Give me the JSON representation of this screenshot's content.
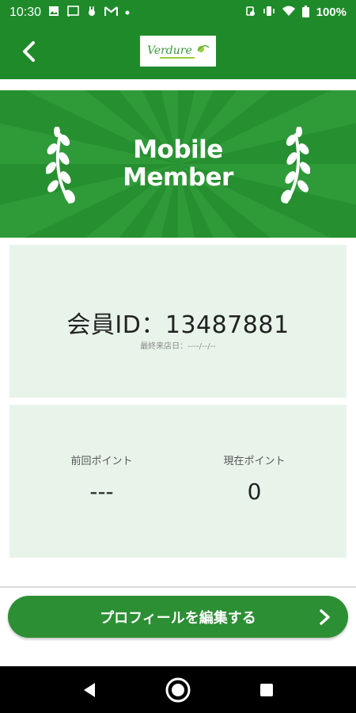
{
  "status_bar": {
    "time": "10:30",
    "left_icons": [
      "image-icon",
      "cast-icon",
      "rabbit-icon",
      "gmail-icon",
      "dot-icon"
    ],
    "right_icons": [
      "vibrate-key-icon",
      "vibrate-icon",
      "wifi-icon",
      "battery-icon"
    ],
    "battery": "100%"
  },
  "header": {
    "logo_text": "Verdure"
  },
  "banner": {
    "title_line1": "Mobile",
    "title_line2": "Member"
  },
  "member_card": {
    "member_id": "会員ID：13487881",
    "last_visit": "最終来店日：----/--/--"
  },
  "points": {
    "previous_label": "前回ポイント",
    "previous_value": "---",
    "current_label": "現在ポイント",
    "current_value": "0"
  },
  "actions": {
    "edit_profile_label": "プロフィールを編集する"
  },
  "colors": {
    "brand_green": "#1f8a2a",
    "banner_green": "#268f30",
    "card_bg": "#e8f4ea"
  }
}
